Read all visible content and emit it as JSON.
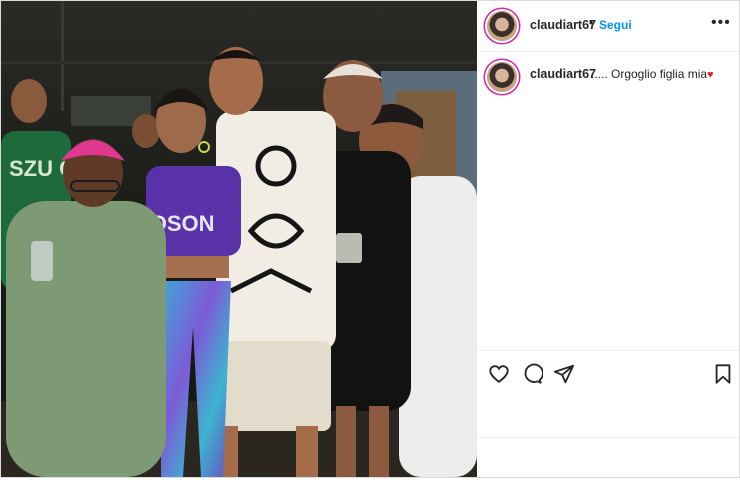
{
  "post": {
    "username": "claudiart67",
    "follow_label": "Segui",
    "separator": "•",
    "more_icon": "more-options-icon",
    "caption": {
      "username": "claudiart67",
      "text": "..... Orgoglio figlia mia",
      "emoji": "♥"
    },
    "photo": {
      "shirt_text_green": "SZU CRU",
      "shirt_text_purple": "DSON"
    },
    "actions": {
      "like_icon": "heart-icon",
      "comment_icon": "comment-icon",
      "share_icon": "share-icon",
      "save_icon": "bookmark-icon"
    }
  },
  "colors": {
    "link_blue": "#0095f6",
    "text": "#262626",
    "heart_red": "#ed1c24",
    "border": "#dbdbdb"
  }
}
